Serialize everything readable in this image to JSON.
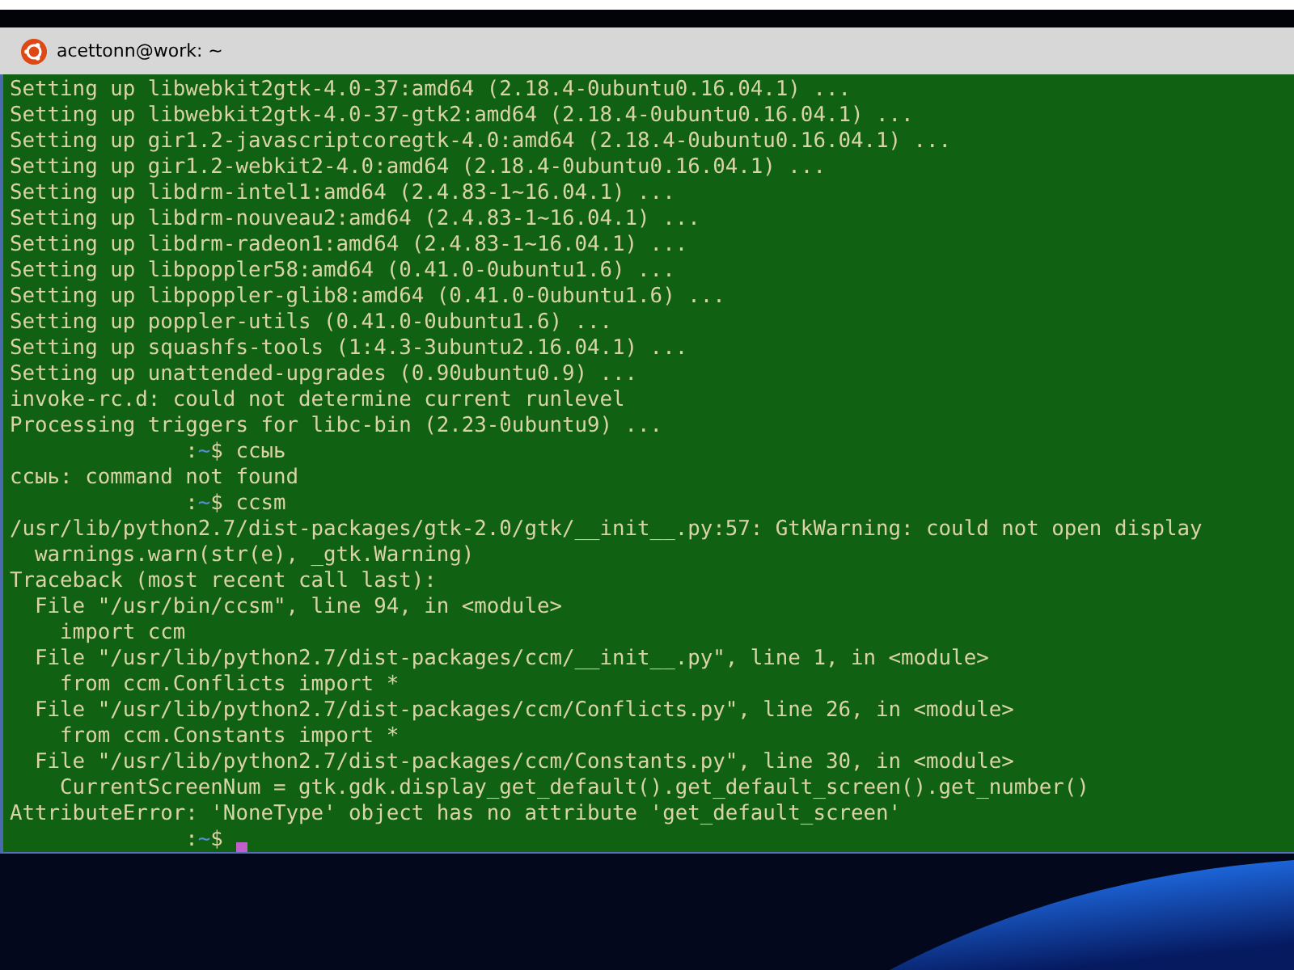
{
  "window": {
    "title": "acettonn@work: ~"
  },
  "terminal": {
    "lines": [
      {
        "kind": "output",
        "text": "Setting up libwebkit2gtk-4.0-37:amd64 (2.18.4-0ubuntu0.16.04.1) ..."
      },
      {
        "kind": "output",
        "text": "Setting up libwebkit2gtk-4.0-37-gtk2:amd64 (2.18.4-0ubuntu0.16.04.1) ..."
      },
      {
        "kind": "output",
        "text": "Setting up gir1.2-javascriptcoregtk-4.0:amd64 (2.18.4-0ubuntu0.16.04.1) ..."
      },
      {
        "kind": "output",
        "text": "Setting up gir1.2-webkit2-4.0:amd64 (2.18.4-0ubuntu0.16.04.1) ..."
      },
      {
        "kind": "output",
        "text": "Setting up libdrm-intel1:amd64 (2.4.83-1~16.04.1) ..."
      },
      {
        "kind": "output",
        "text": "Setting up libdrm-nouveau2:amd64 (2.4.83-1~16.04.1) ..."
      },
      {
        "kind": "output",
        "text": "Setting up libdrm-radeon1:amd64 (2.4.83-1~16.04.1) ..."
      },
      {
        "kind": "output",
        "text": "Setting up libpoppler58:amd64 (0.41.0-0ubuntu1.6) ..."
      },
      {
        "kind": "output",
        "text": "Setting up libpoppler-glib8:amd64 (0.41.0-0ubuntu1.6) ..."
      },
      {
        "kind": "output",
        "text": "Setting up poppler-utils (0.41.0-0ubuntu1.6) ..."
      },
      {
        "kind": "output",
        "text": "Setting up squashfs-tools (1:4.3-3ubuntu2.16.04.1) ..."
      },
      {
        "kind": "output",
        "text": "Setting up unattended-upgrades (0.90ubuntu0.9) ..."
      },
      {
        "kind": "output",
        "text": "invoke-rc.d: could not determine current runlevel"
      },
      {
        "kind": "output",
        "text": "Processing triggers for libc-bin (2.23-0ubuntu9) ..."
      },
      {
        "kind": "prompt",
        "separator": ":",
        "path": "~",
        "symbol": "$",
        "command": "ссыь",
        "cursor": false
      },
      {
        "kind": "output",
        "text": "ссыь: command not found"
      },
      {
        "kind": "prompt",
        "separator": ":",
        "path": "~",
        "symbol": "$",
        "command": "ccsm",
        "cursor": false
      },
      {
        "kind": "output",
        "text": "/usr/lib/python2.7/dist-packages/gtk-2.0/gtk/__init__.py:57: GtkWarning: could not open display"
      },
      {
        "kind": "output",
        "text": "  warnings.warn(str(e), _gtk.Warning)"
      },
      {
        "kind": "output",
        "text": "Traceback (most recent call last):"
      },
      {
        "kind": "output",
        "text": "  File \"/usr/bin/ccsm\", line 94, in <module>"
      },
      {
        "kind": "output",
        "text": "    import ccm"
      },
      {
        "kind": "output",
        "text": "  File \"/usr/lib/python2.7/dist-packages/ccm/__init__.py\", line 1, in <module>"
      },
      {
        "kind": "output",
        "text": "    from ccm.Conflicts import *"
      },
      {
        "kind": "output",
        "text": "  File \"/usr/lib/python2.7/dist-packages/ccm/Conflicts.py\", line 26, in <module>"
      },
      {
        "kind": "output",
        "text": "    from ccm.Constants import *"
      },
      {
        "kind": "output",
        "text": "  File \"/usr/lib/python2.7/dist-packages/ccm/Constants.py\", line 30, in <module>"
      },
      {
        "kind": "output",
        "text": "    CurrentScreenNum = gtk.gdk.display_get_default().get_default_screen().get_number()"
      },
      {
        "kind": "output",
        "text": "AttributeError: 'NoneType' object has no attribute 'get_default_screen'"
      },
      {
        "kind": "prompt",
        "separator": ":",
        "path": "~",
        "symbol": "$",
        "cursor": true
      }
    ]
  }
}
